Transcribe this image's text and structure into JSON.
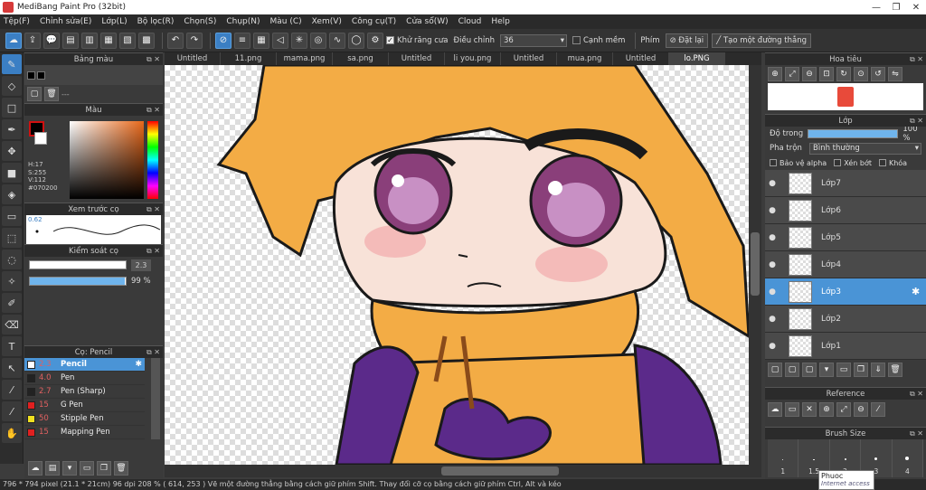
{
  "window": {
    "title": "MediBang Paint Pro (32bit)",
    "minimize": "—",
    "maximize": "❐",
    "close": "✕"
  },
  "menu": [
    "Tệp(F)",
    "Chỉnh sửa(E)",
    "Lớp(L)",
    "Bộ lọc(R)",
    "Chọn(S)",
    "Chụp(N)",
    "Màu (C)",
    "Xem(V)",
    "Công cụ(T)",
    "Cửa sổ(W)",
    "Cloud",
    "Help"
  ],
  "toolbar": {
    "antialias_label": "Khử răng cưa",
    "correction_label": "Điều chỉnh",
    "correction_value": "36",
    "edge_label": "Cạnh mềm",
    "phim_label": "Phím",
    "reset_label": "Đặt lại",
    "straight_line_label": "Tạo một đường thẳng"
  },
  "left": {
    "palette_title": "Bảng màu",
    "palette_dash": "---",
    "color_title": "Màu",
    "color_h": "H:17",
    "color_s": "S:255",
    "color_v": "V:112",
    "color_hex": "#070200",
    "brush_preview_title": "Xem trước cọ",
    "brush_preview_size": "0.62",
    "brush_control_title": "Kiểm soát cọ",
    "brush_size_value": "2.3",
    "brush_opacity": "99 %",
    "brush_list_title": "Cọ: Pencil",
    "brushes": [
      {
        "size": "2.3",
        "name": "Pencil",
        "color": "#ffffff"
      },
      {
        "size": "4.0",
        "name": "Pen",
        "color": "#222222"
      },
      {
        "size": "2.7",
        "name": "Pen (Sharp)",
        "color": "#222222"
      },
      {
        "size": "15",
        "name": "G Pen",
        "color": "#e02020"
      },
      {
        "size": "50",
        "name": "Stipple Pen",
        "color": "#f0e020"
      },
      {
        "size": "15",
        "name": "Mapping Pen",
        "color": "#e02020"
      }
    ]
  },
  "tabs": [
    "Untitled",
    "11.png",
    "mama.png",
    "sa.png",
    "Untitled",
    "li you.png",
    "Untitled",
    "mua.png",
    "Untitled",
    "lo.PNG"
  ],
  "active_tab_index": 9,
  "right": {
    "navigator_title": "Hoa tiêu",
    "layer_title": "Lớp",
    "opacity_label": "Độ trong",
    "opacity_value": "100 %",
    "blend_label": "Pha trộn",
    "blend_value": "Bình thường",
    "protect_alpha": "Bảo vệ alpha",
    "clipping": "Xén bớt",
    "lock": "Khóa",
    "layers": [
      "Lớp7",
      "Lớp6",
      "Lớp5",
      "Lớp4",
      "Lớp3",
      "Lớp2",
      "Lớp1"
    ],
    "selected_layer_index": 4,
    "reference_title": "Reference",
    "brushsize_title": "Brush Size",
    "brushsizes": [
      "1",
      "1.5",
      "2",
      "3",
      "4"
    ]
  },
  "status": "796 * 794 pixel   (21.1 * 21cm)   96 dpi   208 %   ( 614, 253 )   Vẽ một đường thẳng bằng cách giữ phím Shift. Thay đổi cỡ cọ bằng cách giữ phím Ctrl, Alt và kéo",
  "tooltip": {
    "title": "Phuoc",
    "sub": "Internet access"
  }
}
